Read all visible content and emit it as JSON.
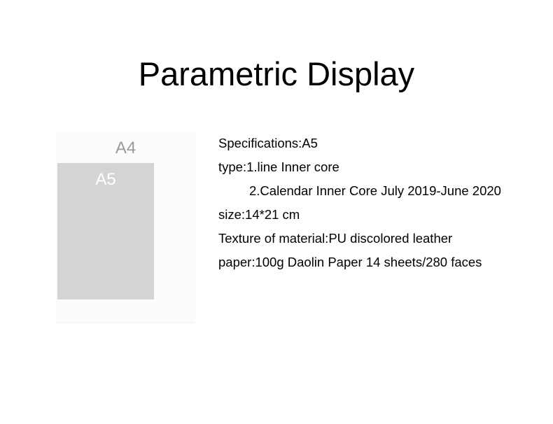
{
  "title": "Parametric Display",
  "diagram": {
    "a4_label": "A4",
    "a5_label": "A5"
  },
  "specs": {
    "line1": "Specifications:A5",
    "line2": "type:1.line Inner core",
    "line3": "2.Calendar Inner Core July 2019-June 2020",
    "line4": "size:14*21 cm",
    "line5": "Texture of material:PU discolored leather",
    "line6": "paper:100g Daolin Paper 14 sheets/280 faces"
  }
}
